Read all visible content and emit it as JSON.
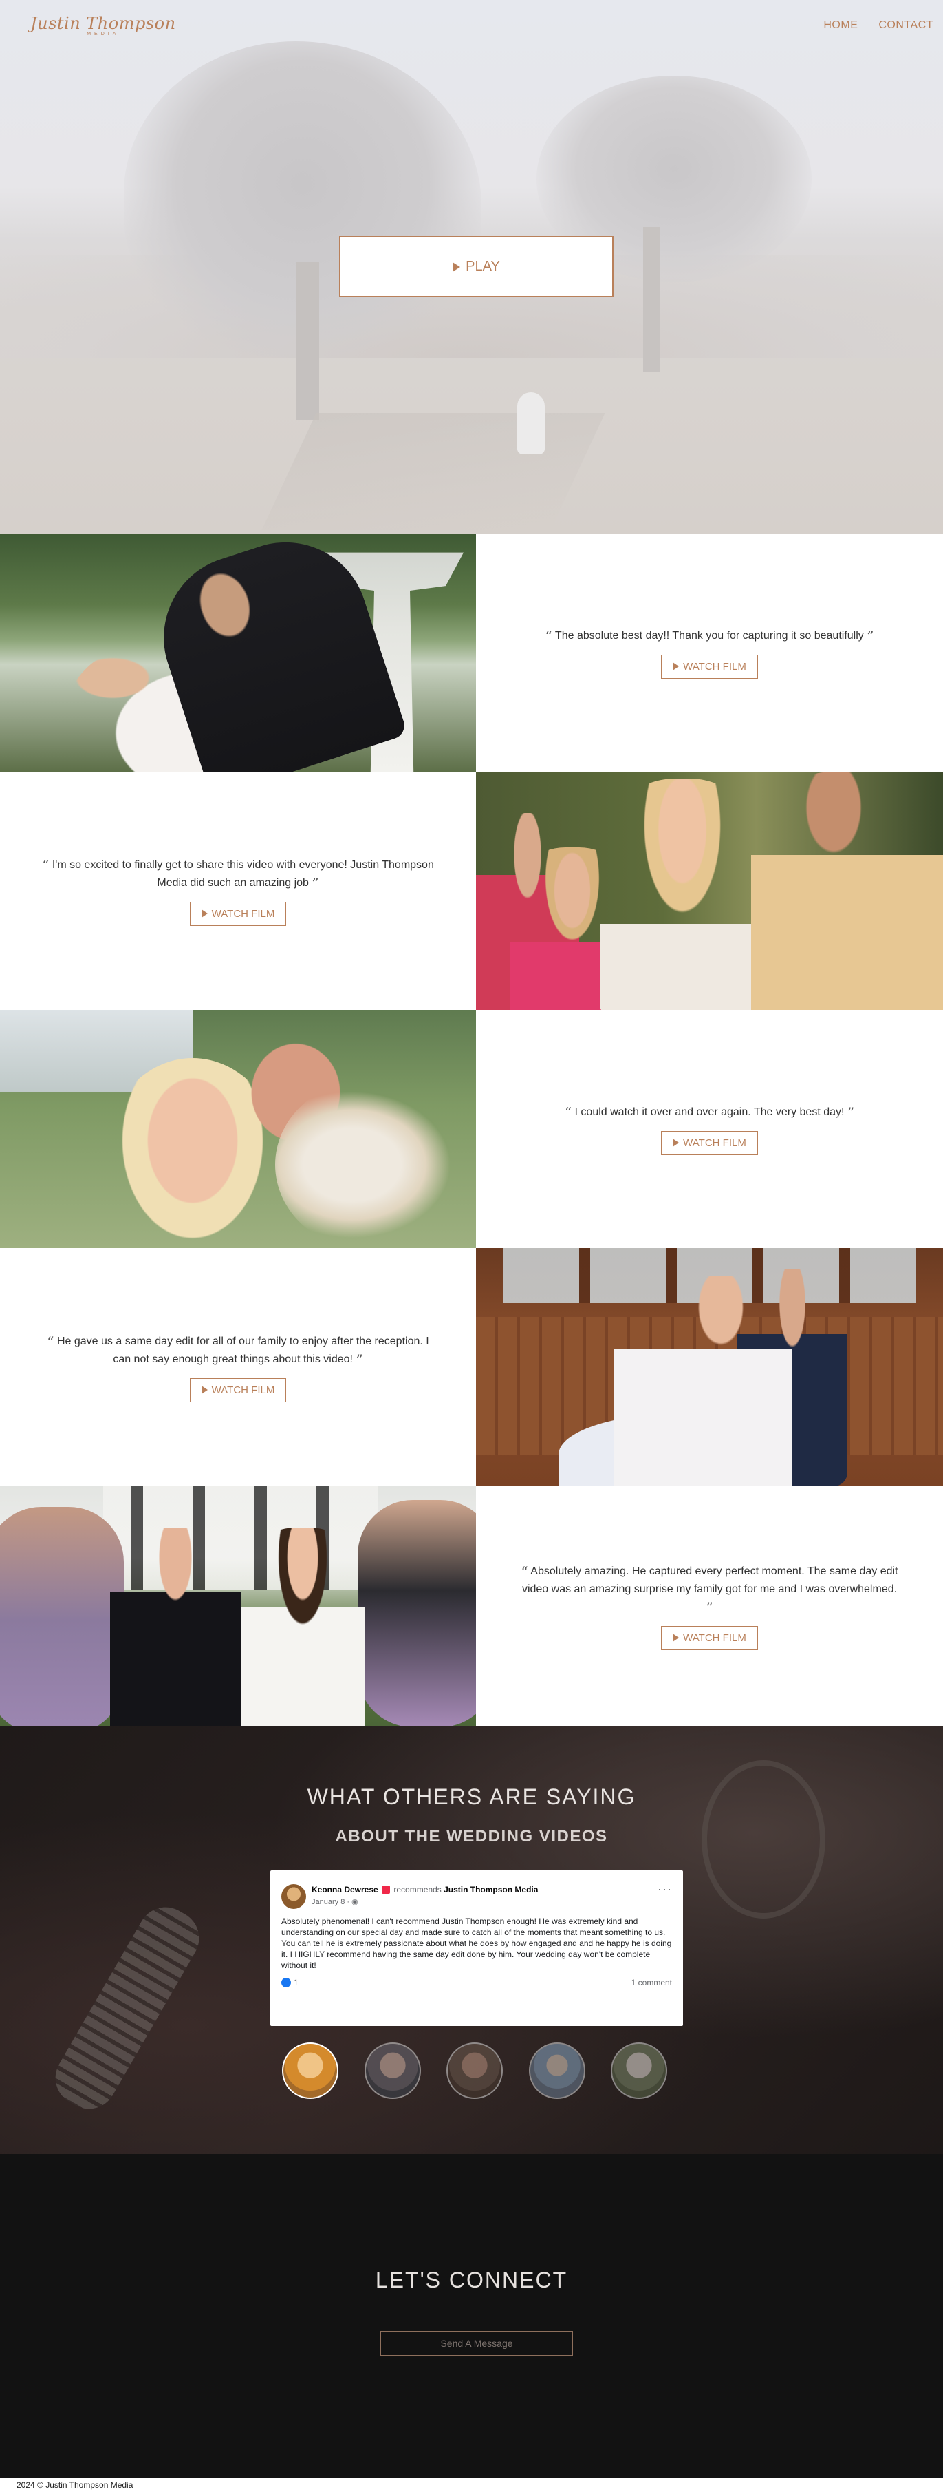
{
  "brand": {
    "logo_main": "Justin Thompson",
    "logo_sub": "MEDIA"
  },
  "nav": {
    "home": "HOME",
    "contact": "CONTACT"
  },
  "colors": {
    "accent": "#b9805a",
    "dark": "#121212",
    "facebook_blue": "#1877f2",
    "recommend_red": "#f02849"
  },
  "hero": {
    "play_label": "PLAY",
    "play_icon": "play-icon"
  },
  "films": [
    {
      "quote": "The absolute best day!! Thank you for capturing it so beautifully",
      "button": "WATCH FILM"
    },
    {
      "quote": "I'm so excited to finally get to share this video with everyone! Justin Thompson Media did such an amazing job",
      "button": "WATCH FILM"
    },
    {
      "quote": "I could watch it over and over again. The very best day!",
      "button": "WATCH FILM"
    },
    {
      "quote": "He gave us a same day edit for all of our family to enjoy after the reception. I can not say enough great things about this video!",
      "button": "WATCH FILM"
    },
    {
      "quote": "Absolutely amazing. He captured every perfect moment. The same day edit video was an amazing surprise my family got for me and I was overwhelmed.",
      "button": "WATCH FILM"
    }
  ],
  "quote_marks": {
    "open": "“",
    "close": "”"
  },
  "testimonials": {
    "title": "WHAT OTHERS ARE SAYING",
    "subtitle": "ABOUT THE WEDDING VIDEOS",
    "review": {
      "reviewer": "Keonna Dewrese",
      "verb": "recommends",
      "page": "Justin Thompson Media",
      "date": "January 8 · ",
      "more": "···",
      "body": "Absolutely phenomenal! I can't recommend Justin Thompson enough! He was extremely kind and understanding on our special day and made sure to catch all of the moments that meant something to us. You can tell he is extremely passionate about what he does by how engaged and and he happy he is doing it. I HIGHLY recommend having the same day edit done by him. Your wedding day won't be complete without it!",
      "likes": "1",
      "comments": "1 comment"
    }
  },
  "connect": {
    "title": "LET'S CONNECT",
    "button": "Send A Message"
  },
  "footer": {
    "copyright": "2024 © Justin Thompson Media"
  }
}
